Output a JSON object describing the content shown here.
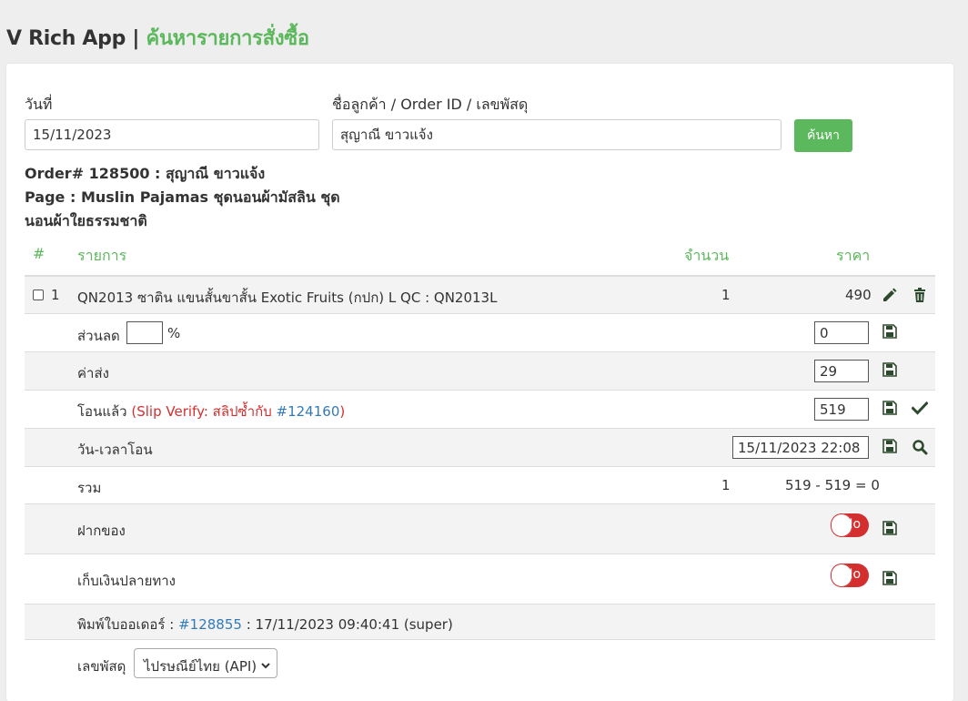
{
  "header": {
    "app_name": "V Rich App",
    "separator": "|",
    "page_title": "ค้นหารายการสั่งซื้อ"
  },
  "search": {
    "date_label": "วันที่",
    "date_value": "15/11/2023",
    "query_label": "ชื่อลูกค้า / Order ID / เลขพัสดุ",
    "query_value": "สุญาณี ขาวแจ้ง",
    "button_label": "ค้นหา"
  },
  "order": {
    "order_line": "Order# 128500 : สุญาณี ขาวแจ้ง",
    "page_line1": "Page : Muslin Pajamas ชุดนอนผ้ามัสลิน ชุด",
    "page_line2": "นอนผ้าใยธรรมชาติ"
  },
  "table": {
    "headers": {
      "no": "#",
      "item": "รายการ",
      "qty": "จำนวน",
      "price": "ราคา"
    },
    "item": {
      "index": "1",
      "name": "QN2013 ซาติน แขนสั้นขาสั้น Exotic Fruits (กปก) L QC : QN2013L",
      "qty": "1",
      "price": "490"
    },
    "discount": {
      "label": "ส่วนลด",
      "percent_value": "",
      "percent_sign": "%",
      "value": "0"
    },
    "shipping": {
      "label": "ค่าส่ง",
      "value": "29"
    },
    "transfer": {
      "label": "โอนแล้ว",
      "slip_prefix": "(Slip Verify: สลิปซ้ำกับ",
      "slip_link": "#124160",
      "slip_suffix": ")",
      "value": "519"
    },
    "transfer_time": {
      "label": "วัน-เวลาโอน",
      "value": "15/11/2023 22:08"
    },
    "total": {
      "label": "รวม",
      "qty": "1",
      "calc": "519 - 519 = 0"
    },
    "deposit": {
      "label": "ฝากของ",
      "toggle": "No"
    },
    "cod": {
      "label": "เก็บเงินปลายทาง",
      "toggle": "No"
    },
    "print": {
      "label": "พิมพ์ใบออเดอร์ :",
      "link": "#128855",
      "info": ": 17/11/2023 09:40:41 (super)"
    },
    "tracking": {
      "label": "เลขพัสดุ",
      "carrier": "ไปรษณีย์ไทย (API)"
    }
  },
  "colors": {
    "accent": "#5cb85c",
    "danger": "#d32f2f",
    "link": "#337ab7",
    "icon": "#2e4a2e"
  }
}
